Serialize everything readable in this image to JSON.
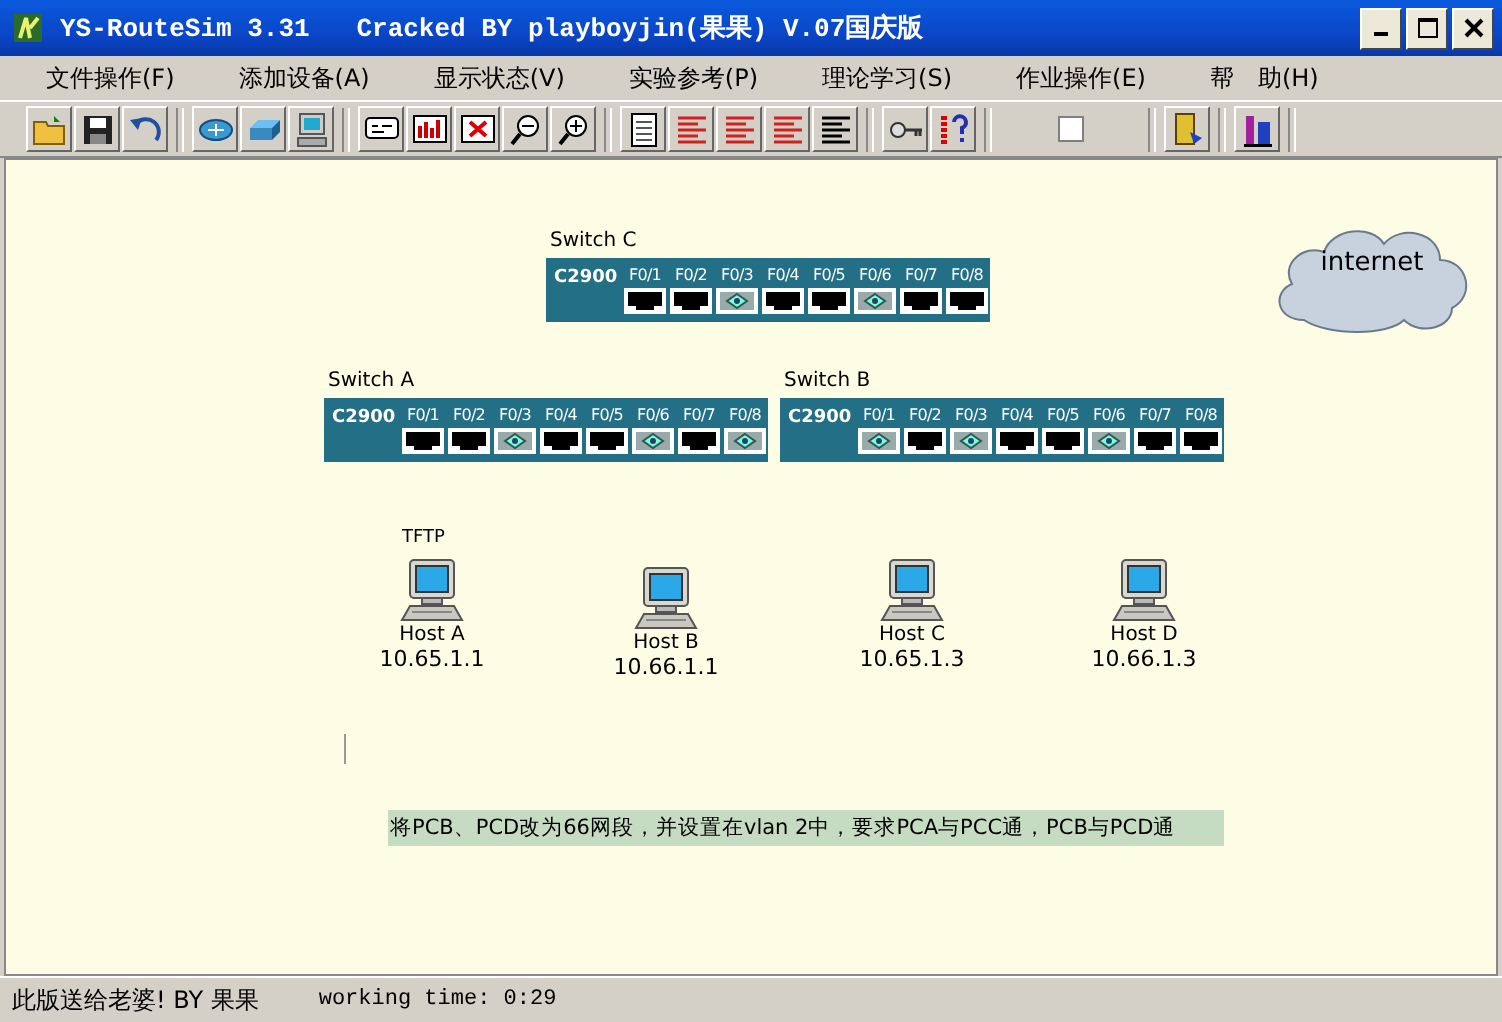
{
  "window": {
    "title": "YS-RouteSim 3.31   Cracked BY playboyjin(果果) V.07国庆版"
  },
  "menu": [
    {
      "label": "文件操作(F)"
    },
    {
      "label": "添加设备(A)"
    },
    {
      "label": "显示状态(V)"
    },
    {
      "label": "实验参考(P)"
    },
    {
      "label": "理论学习(S)"
    },
    {
      "label": "作业操作(E)"
    },
    {
      "label": "帮　助(H)"
    }
  ],
  "toolbar": {
    "checkbox": {
      "checked": false
    }
  },
  "switches": [
    {
      "label": "Switch C",
      "model": "C2900",
      "ports": [
        {
          "label": "F0/1",
          "kind": "empty"
        },
        {
          "label": "F0/2",
          "kind": "empty"
        },
        {
          "label": "F0/3",
          "kind": "linked"
        },
        {
          "label": "F0/4",
          "kind": "empty"
        },
        {
          "label": "F0/5",
          "kind": "empty"
        },
        {
          "label": "F0/6",
          "kind": "linked"
        },
        {
          "label": "F0/7",
          "kind": "empty"
        },
        {
          "label": "F0/8",
          "kind": "empty"
        }
      ]
    },
    {
      "label": "Switch A",
      "model": "C2900",
      "ports": [
        {
          "label": "F0/1",
          "kind": "empty"
        },
        {
          "label": "F0/2",
          "kind": "empty"
        },
        {
          "label": "F0/3",
          "kind": "linked"
        },
        {
          "label": "F0/4",
          "kind": "empty"
        },
        {
          "label": "F0/5",
          "kind": "empty"
        },
        {
          "label": "F0/6",
          "kind": "linked"
        },
        {
          "label": "F0/7",
          "kind": "empty"
        },
        {
          "label": "F0/8",
          "kind": "linked"
        }
      ]
    },
    {
      "label": "Switch B",
      "model": "C2900",
      "ports": [
        {
          "label": "F0/1",
          "kind": "linked"
        },
        {
          "label": "F0/2",
          "kind": "empty"
        },
        {
          "label": "F0/3",
          "kind": "linked"
        },
        {
          "label": "F0/4",
          "kind": "empty"
        },
        {
          "label": "F0/5",
          "kind": "empty"
        },
        {
          "label": "F0/6",
          "kind": "linked"
        },
        {
          "label": "F0/7",
          "kind": "empty"
        },
        {
          "label": "F0/8",
          "kind": "empty"
        }
      ]
    }
  ],
  "cloud": {
    "label": "internet"
  },
  "hosts": [
    {
      "tag": "TFTP",
      "name": "Host A",
      "ip": "10.65.1.1"
    },
    {
      "name": "Host B",
      "ip": "10.66.1.1"
    },
    {
      "name": "Host C",
      "ip": "10.65.1.3"
    },
    {
      "name": "Host D",
      "ip": "10.66.1.3"
    }
  ],
  "note": "将PCB、PCD改为66网段，并设置在vlan 2中，要求PCA与PCC通，PCB与PCD通",
  "status_bar": {
    "message": "此版送给老婆! BY 果果",
    "working_time": "working time: 0:29"
  }
}
